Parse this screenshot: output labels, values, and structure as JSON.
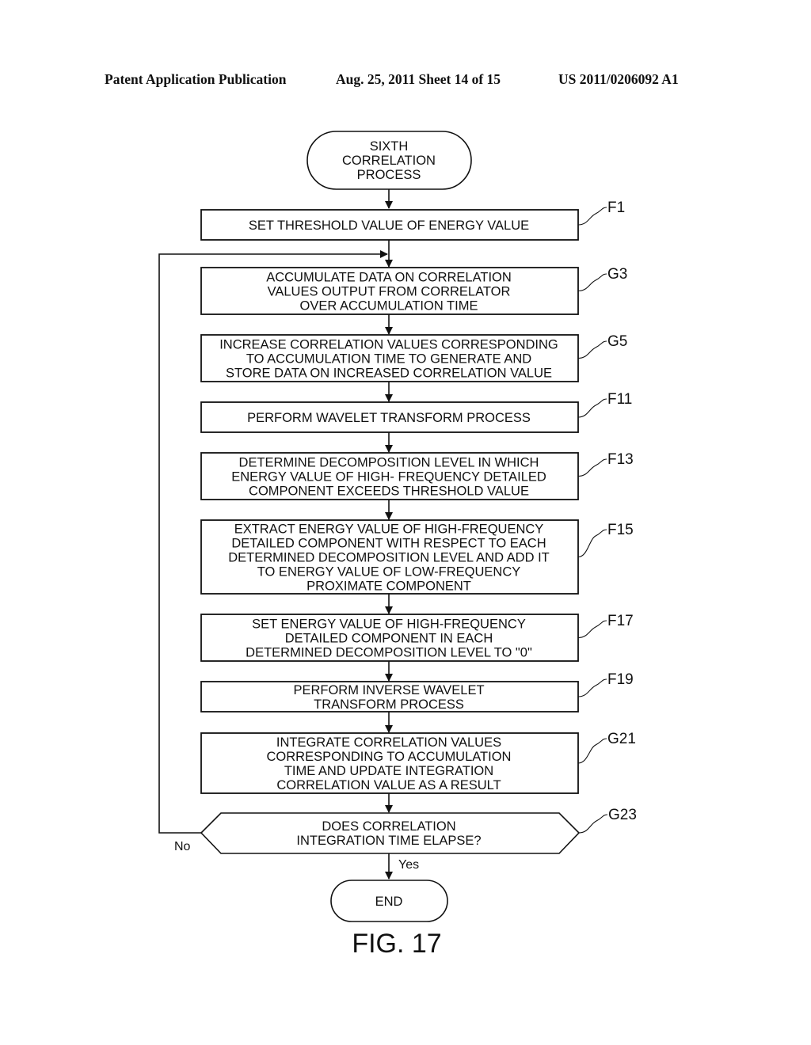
{
  "header": {
    "publication": "Patent Application Publication",
    "date_sheet": "Aug. 25, 2011  Sheet 14 of 15",
    "patent_number": "US 2011/0206092 A1"
  },
  "flowchart": {
    "start": {
      "lines": [
        "SIXTH",
        "CORRELATION",
        "PROCESS"
      ]
    },
    "steps": [
      {
        "ref": "F1",
        "lines": [
          "SET THRESHOLD VALUE OF ENERGY VALUE"
        ]
      },
      {
        "ref": "G3",
        "lines": [
          "ACCUMULATE DATA ON CORRELATION",
          "VALUES OUTPUT FROM CORRELATOR",
          "OVER ACCUMULATION TIME"
        ]
      },
      {
        "ref": "G5",
        "lines": [
          "INCREASE CORRELATION VALUES CORRESPONDING",
          "TO ACCUMULATION TIME TO GENERATE AND",
          "STORE DATA ON INCREASED CORRELATION VALUE"
        ]
      },
      {
        "ref": "F11",
        "lines": [
          "PERFORM WAVELET TRANSFORM PROCESS"
        ]
      },
      {
        "ref": "F13",
        "lines": [
          "DETERMINE DECOMPOSITION LEVEL IN WHICH",
          "ENERGY VALUE OF HIGH- FREQUENCY DETAILED",
          "COMPONENT EXCEEDS THRESHOLD VALUE"
        ]
      },
      {
        "ref": "F15",
        "lines": [
          "EXTRACT ENERGY VALUE OF HIGH-FREQUENCY",
          "DETAILED COMPONENT WITH RESPECT TO EACH",
          "DETERMINED DECOMPOSITION LEVEL AND ADD IT",
          "TO ENERGY VALUE OF LOW-FREQUENCY",
          "PROXIMATE COMPONENT"
        ]
      },
      {
        "ref": "F17",
        "lines": [
          "SET ENERGY VALUE OF HIGH-FREQUENCY",
          "DETAILED COMPONENT IN EACH",
          "DETERMINED DECOMPOSITION LEVEL TO \"0\""
        ]
      },
      {
        "ref": "F19",
        "lines": [
          "PERFORM INVERSE WAVELET",
          "TRANSFORM PROCESS"
        ]
      },
      {
        "ref": "G21",
        "lines": [
          "INTEGRATE CORRELATION VALUES",
          "CORRESPONDING TO ACCUMULATION",
          "TIME AND UPDATE INTEGRATION",
          "CORRELATION VALUE AS A RESULT"
        ]
      }
    ],
    "decision": {
      "ref": "G23",
      "lines": [
        "DOES CORRELATION",
        "INTEGRATION TIME ELAPSE?"
      ],
      "no_label": "No",
      "yes_label": "Yes"
    },
    "end": {
      "lines": [
        "END"
      ]
    }
  },
  "figure_label": "FIG. 17"
}
